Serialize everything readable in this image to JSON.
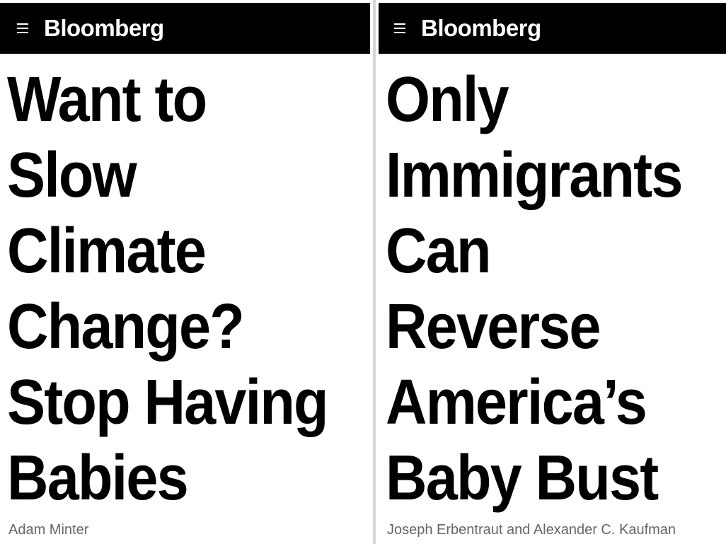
{
  "left": {
    "brand": "Bloomberg",
    "headline_lines": [
      "Want to",
      "Slow",
      "Climate",
      "Change?",
      "Stop Having",
      "Babies"
    ],
    "byline": "Adam Minter"
  },
  "right": {
    "brand": "Bloomberg",
    "headline_lines": [
      "Only",
      "Immigrants",
      "Can",
      "Reverse",
      "America’s",
      "Baby Bust"
    ],
    "byline": "Joseph Erbentraut and Alexander C. Kaufman"
  },
  "colors": {
    "topbar": "#000000",
    "brand_text": "#ffffff",
    "headline": "#000000",
    "byline": "#666666"
  },
  "icons": {
    "menu": "hamburger-menu-icon"
  }
}
